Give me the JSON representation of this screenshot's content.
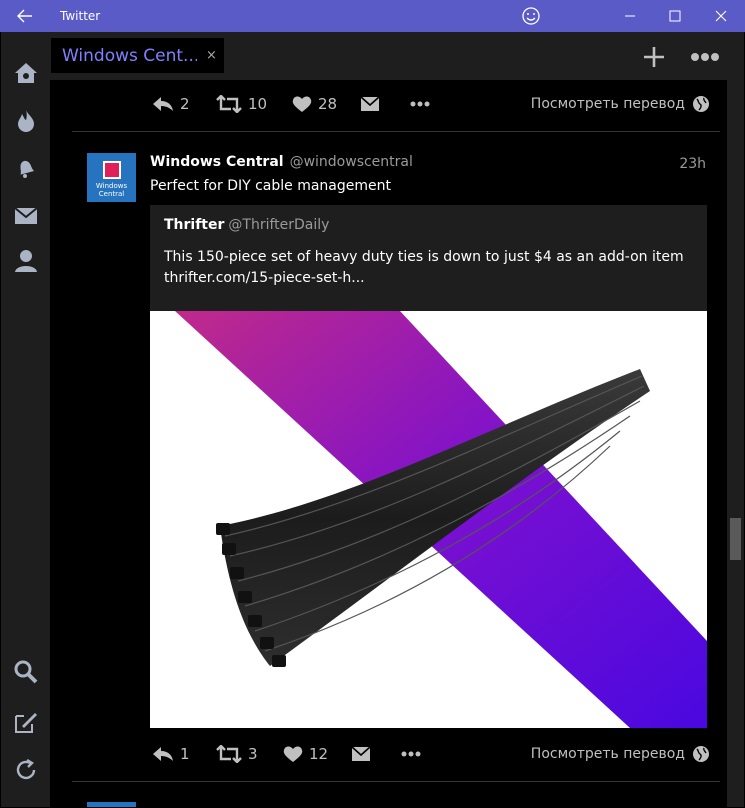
{
  "window": {
    "title": "Twitter"
  },
  "column": {
    "tab_label": "Windows Cent...",
    "close_glyph": "×"
  },
  "prev_tweet": {
    "reply_count": "2",
    "retweet_count": "10",
    "like_count": "28",
    "translate_label": "Посмотреть перевод"
  },
  "tweet": {
    "avatar_text_line1": "Windows",
    "avatar_text_line2": "Central",
    "author_name": "Windows Central",
    "author_handle": "@windowscentral",
    "time": "23h",
    "text": "Perfect for DIY cable management",
    "quote": {
      "author_name": "Thrifter",
      "author_handle": "@ThrifterDaily",
      "text_line1": "This 150-piece set of heavy duty ties is down to just $4 as an add-on item",
      "text_line2": "thrifter.com/15-piece-set-h..."
    },
    "reply_count": "1",
    "retweet_count": "3",
    "like_count": "12",
    "translate_label": "Посмотреть перевод"
  },
  "colors": {
    "accent": "#5b5bc8",
    "tab_text": "#8080ff",
    "nav_bg": "#1e1e1e",
    "feed_bg": "#000000"
  },
  "icons": [
    "back-arrow-icon",
    "emoji-icon",
    "minimize-icon",
    "maximize-icon",
    "close-icon",
    "home-icon",
    "trending-fire-icon",
    "bell-icon",
    "mail-icon",
    "profile-icon",
    "search-icon",
    "compose-icon",
    "refresh-icon",
    "plus-icon",
    "more-icon",
    "reply-icon",
    "retweet-icon",
    "heart-icon",
    "dm-icon",
    "globe-icon"
  ]
}
